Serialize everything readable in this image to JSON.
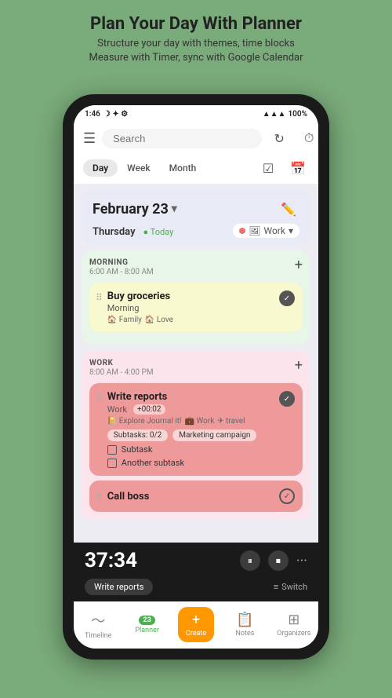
{
  "header": {
    "title": "Plan Your Day With Planner",
    "subtitle": "Structure your day with themes, time blocks\nMeasure with Timer, sync with Google Calendar"
  },
  "statusBar": {
    "time": "1:46",
    "battery": "100%"
  },
  "topBar": {
    "searchPlaceholder": "Search"
  },
  "tabs": {
    "items": [
      "Day",
      "Week",
      "Month"
    ],
    "active": "Day"
  },
  "dateHeader": {
    "date": "February 23",
    "dayName": "Thursday",
    "todayLabel": "Today",
    "workLabel": "Work",
    "workChevron": "▼"
  },
  "sections": {
    "morning": {
      "title": "MORNING",
      "time": "6:00 AM - 8:00 AM",
      "tasks": [
        {
          "title": "Buy groceries",
          "sub": "Morning",
          "tags": [
            "Family",
            "Love"
          ],
          "checked": true
        }
      ]
    },
    "work": {
      "title": "WORK",
      "time": "8:00 AM - 4:00 PM",
      "tasks": [
        {
          "title": "Write reports",
          "sub": "Work",
          "timer": "+00:02",
          "tags": [
            "Explore Journal it!",
            "Work",
            "travel"
          ],
          "subtaskBadges": [
            "Subtasks: 0/2",
            "Marketing campaign"
          ],
          "subtasks": [
            "Subtask",
            "Another subtask"
          ],
          "checked": true
        }
      ],
      "callBoss": "Call boss"
    }
  },
  "timerBar": {
    "time": "37:34",
    "taskLabel": "Write reports",
    "switchLabel": "Switch"
  },
  "bottomNav": {
    "items": [
      {
        "label": "Timeline",
        "icon": "↗"
      },
      {
        "label": "Planner",
        "icon": "23",
        "active": true
      },
      {
        "label": "Create",
        "icon": "+"
      },
      {
        "label": "Notes",
        "icon": "📋"
      },
      {
        "label": "Organizers",
        "icon": "⊞"
      }
    ]
  }
}
